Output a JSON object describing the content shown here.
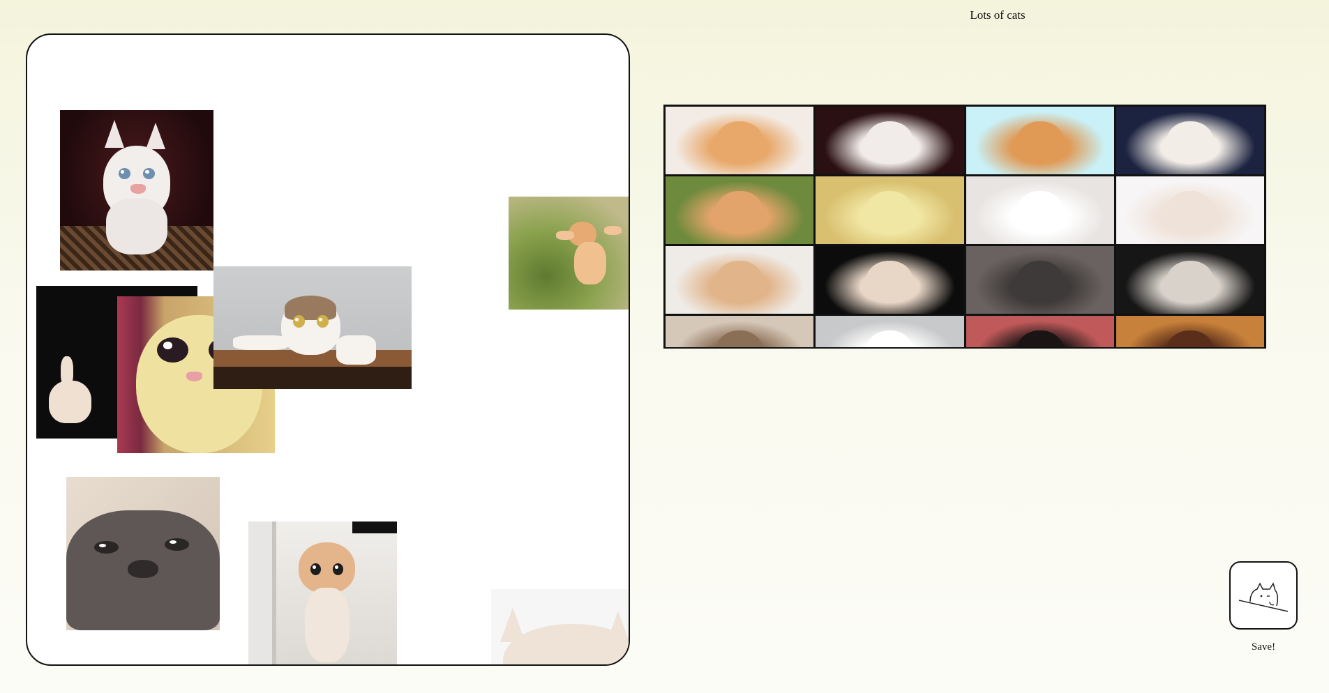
{
  "header": {
    "title": "Lots of cats"
  },
  "board": {
    "stickers": [
      {
        "name": "sticker-white-kitten",
        "palette": [
          "#2a1012",
          "#f1ecea",
          "#5a3e2a"
        ]
      },
      {
        "name": "sticker-jumping-orange-cat",
        "palette": [
          "#6e8a3c",
          "#e2a46a",
          "#a9b26a"
        ]
      },
      {
        "name": "sticker-thumbs-up-cat",
        "palette": [
          "#0c0c0c",
          "#e8d6c6",
          "#b88c6e"
        ]
      },
      {
        "name": "sticker-smiling-cat",
        "palette": [
          "#8e2d4a",
          "#f1e7a4",
          "#d9c070"
        ]
      },
      {
        "name": "sticker-shocked-cat-on-shelf",
        "palette": [
          "#c8c9ca",
          "#ffffff",
          "#8a5a3a"
        ]
      },
      {
        "name": "sticker-blurry-grey-cat",
        "palette": [
          "#e4d8cc",
          "#5a5453",
          "#3e3a39"
        ]
      },
      {
        "name": "sticker-standing-orange-kitten",
        "palette": [
          "#efece8",
          "#e1b48a",
          "#d6d2cc"
        ]
      },
      {
        "name": "sticker-white-cat-peeking",
        "palette": [
          "#f4f4f4",
          "#efe4da",
          "#d8c4b4"
        ]
      }
    ]
  },
  "gallery": {
    "tiles": [
      {
        "label": "sleeping-orange-cat",
        "palette": [
          "#f3ece6",
          "#e8a86a"
        ]
      },
      {
        "label": "white-kitten",
        "palette": [
          "#2a1012",
          "#f1ecea"
        ]
      },
      {
        "label": "cat-with-glasses",
        "palette": [
          "#c9f1f7",
          "#e09a56"
        ]
      },
      {
        "label": "white-cat-hands",
        "palette": [
          "#1c2340",
          "#f2ede6"
        ]
      },
      {
        "label": "jumping-orange-cat",
        "palette": [
          "#6e8a3c",
          "#e2a46a"
        ]
      },
      {
        "label": "smiling-cat",
        "palette": [
          "#d9c070",
          "#f1e7a4"
        ]
      },
      {
        "label": "polite-cat",
        "palette": [
          "#e8e4e2",
          "#ffffff"
        ]
      },
      {
        "label": "white-cat-squint",
        "palette": [
          "#f7f5f5",
          "#efe2d8"
        ]
      },
      {
        "label": "standing-kitten",
        "palette": [
          "#efece8",
          "#e1b48a"
        ]
      },
      {
        "label": "thumbs-up-cat",
        "palette": [
          "#0c0c0c",
          "#e8d6c6"
        ]
      },
      {
        "label": "blurry-grey-cat",
        "palette": [
          "#6a6261",
          "#3e3a39"
        ]
      },
      {
        "label": "grumpy-cat",
        "palette": [
          "#161616",
          "#d8d2ca"
        ]
      },
      {
        "label": "lying-tabby-cat",
        "palette": [
          "#d6c8b8",
          "#8a6e56"
        ]
      },
      {
        "label": "shocked-cat",
        "palette": [
          "#c8c9ca",
          "#ffffff"
        ]
      },
      {
        "label": "black-cat-tongue",
        "palette": [
          "#c05a5a",
          "#1a1414"
        ]
      },
      {
        "label": "cat-eyes-closeup",
        "palette": [
          "#c8813a",
          "#5a2e1a"
        ]
      }
    ]
  },
  "save": {
    "label": "Save!",
    "icon": "cat-peeking-icon"
  }
}
